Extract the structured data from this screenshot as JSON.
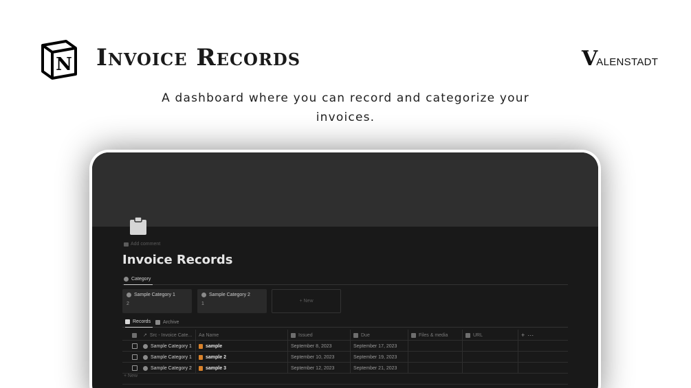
{
  "header": {
    "title": "Invoice Records",
    "subtitle": "A dashboard where you can record and categorize your invoices.",
    "brand": {
      "initial": "V",
      "rest": "ALENSTADT"
    },
    "logo_icon": "notion-logo-icon"
  },
  "notion_page": {
    "icon": "clipboard-icon",
    "add_comment_label": "Add comment",
    "title": "Invoice Records",
    "category_view": {
      "tab_label": "Category",
      "cards": [
        {
          "title": "Sample Category 1",
          "count": "2"
        },
        {
          "title": "Sample Category 2",
          "count": "1"
        }
      ],
      "new_label": "+ New"
    },
    "records_view": {
      "tabs": [
        {
          "label": "Records",
          "active": true
        },
        {
          "label": "Archive",
          "active": false
        }
      ],
      "columns": {
        "src": "Src - Invoice Cate...",
        "name": "Aa Name",
        "issued": "Issued",
        "due": "Due",
        "files": "Files & media",
        "url": "URL",
        "add": "+",
        "more": "⋯"
      },
      "rows": [
        {
          "category": "Sample Category 1",
          "name": "sample",
          "issued": "September 8, 2023",
          "due": "September 17, 2023"
        },
        {
          "category": "Sample Category 1",
          "name": "sample 2",
          "issued": "September 10, 2023",
          "due": "September 19, 2023"
        },
        {
          "category": "Sample Category 2",
          "name": "sample 3",
          "issued": "September 12, 2023",
          "due": "September 21, 2023"
        }
      ],
      "new_label": "+ New"
    }
  },
  "colors": {
    "accent_doc_icon": "#d9822b",
    "screen_bg": "#191919",
    "cover_bg": "#2f2f2f"
  }
}
